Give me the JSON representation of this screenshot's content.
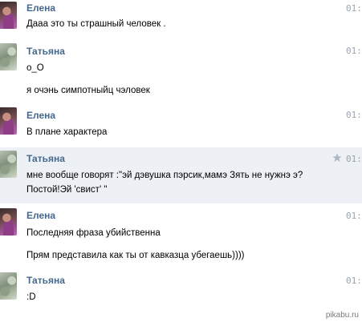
{
  "messages": [
    {
      "author": "Елена",
      "time": "01:",
      "avatar": "elena-avatar",
      "lines": [
        "Дааа это ты страшный человек ."
      ]
    },
    {
      "author": "Татьяна",
      "time": "01:",
      "avatar": "tatyana-avatar",
      "lines": [
        "о_О",
        "я очэнь симпотныйц чэловек"
      ]
    },
    {
      "author": "Елена",
      "time": "01:",
      "avatar": "elena-avatar",
      "lines": [
        "В плане характера"
      ]
    },
    {
      "author": "Татьяна",
      "time": "01:",
      "avatar": "tatyana-avatar",
      "highlighted": true,
      "star_icon": "star-icon",
      "lines": [
        "мне вообще говорят :\"эй дэвушка пэрсик,мамэ Зять не нужнэ э?",
        "Постой!Эй 'свист' \""
      ]
    },
    {
      "author": "Елена",
      "time": "01:",
      "avatar": "elena-avatar",
      "lines": [
        "Последняя фраза убийственна",
        "Прям представила как ты от кавказца убегаешь))))"
      ]
    },
    {
      "author": "Татьяна",
      "time": "01:",
      "avatar": "tatyana-avatar",
      "lines": [
        ":D"
      ]
    }
  ],
  "watermark": "pikabu.ru",
  "colors": {
    "author": "#45688e",
    "time": "#9aa3ad",
    "highlight": "#edf1f5"
  }
}
